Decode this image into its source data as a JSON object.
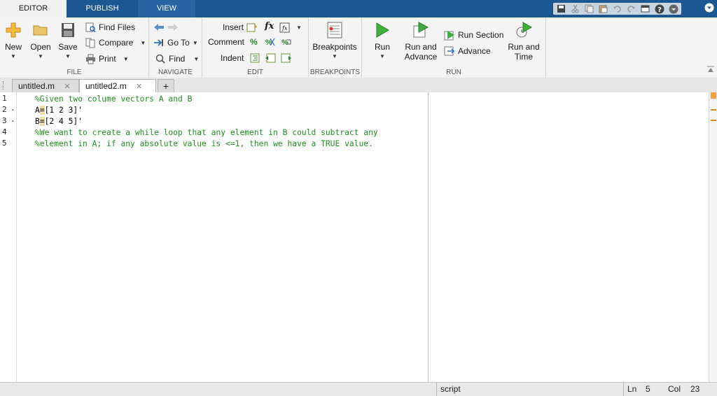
{
  "toolstrip_tabs": [
    {
      "label": "EDITOR",
      "active": true
    },
    {
      "label": "PUBLISH",
      "active": false
    },
    {
      "label": "VIEW",
      "active": false
    }
  ],
  "quick_access": [
    "save-icon",
    "cut-icon",
    "copy-icon",
    "paste-icon",
    "undo-icon",
    "redo-icon",
    "window-layout-icon",
    "help-icon",
    "search-docs-icon"
  ],
  "file_group": {
    "label": "FILE",
    "new": "New",
    "open": "Open",
    "save": "Save",
    "find_files": "Find Files",
    "compare": "Compare",
    "print": "Print"
  },
  "navigate_group": {
    "label": "NAVIGATE",
    "go_to": "Go To",
    "find": "Find"
  },
  "edit_group": {
    "label": "EDIT",
    "insert": "Insert",
    "comment": "Comment",
    "indent": "Indent",
    "fx": "fx"
  },
  "breakpoints_group": {
    "label": "BREAKPOINTS",
    "breakpoints": "Breakpoints"
  },
  "run_group": {
    "label": "RUN",
    "run": "Run",
    "run_and_advance_1": "Run and",
    "run_and_advance_2": "Advance",
    "run_section": "Run Section",
    "advance": "Advance",
    "run_and_time_1": "Run and",
    "run_and_time_2": "Time"
  },
  "file_tabs": [
    {
      "label": "untitled.m",
      "active": false
    },
    {
      "label": "untitled2.m",
      "active": true
    }
  ],
  "add_tab": "+",
  "editor": {
    "lines": [
      {
        "num": "1",
        "dash": "",
        "pre": "%Given two colume vectors A and B",
        "mark": "",
        "post": "",
        "comment": true
      },
      {
        "num": "2",
        "dash": "-",
        "pre": "A",
        "mark": "=",
        "post": "[1 2 3]'",
        "comment": false
      },
      {
        "num": "3",
        "dash": "-",
        "pre": "B",
        "mark": "=",
        "post": "[2 4 5]'",
        "comment": false
      },
      {
        "num": "4",
        "dash": "",
        "pre": "%We want to create a while loop that any element in B could subtract any",
        "mark": "",
        "post": "",
        "comment": true
      },
      {
        "num": "5",
        "dash": "",
        "pre": "%element in A; if any absolute value is <=1, then we have a TRUE value.",
        "mark": "",
        "post": "",
        "comment": true
      }
    ]
  },
  "status": {
    "mode": "script",
    "ln_label": "Ln",
    "ln": "5",
    "col_label": "Col",
    "col": "23"
  },
  "colors": {
    "topbar": "#1d5793",
    "comment": "#228b22",
    "marker": "#e8821e"
  }
}
